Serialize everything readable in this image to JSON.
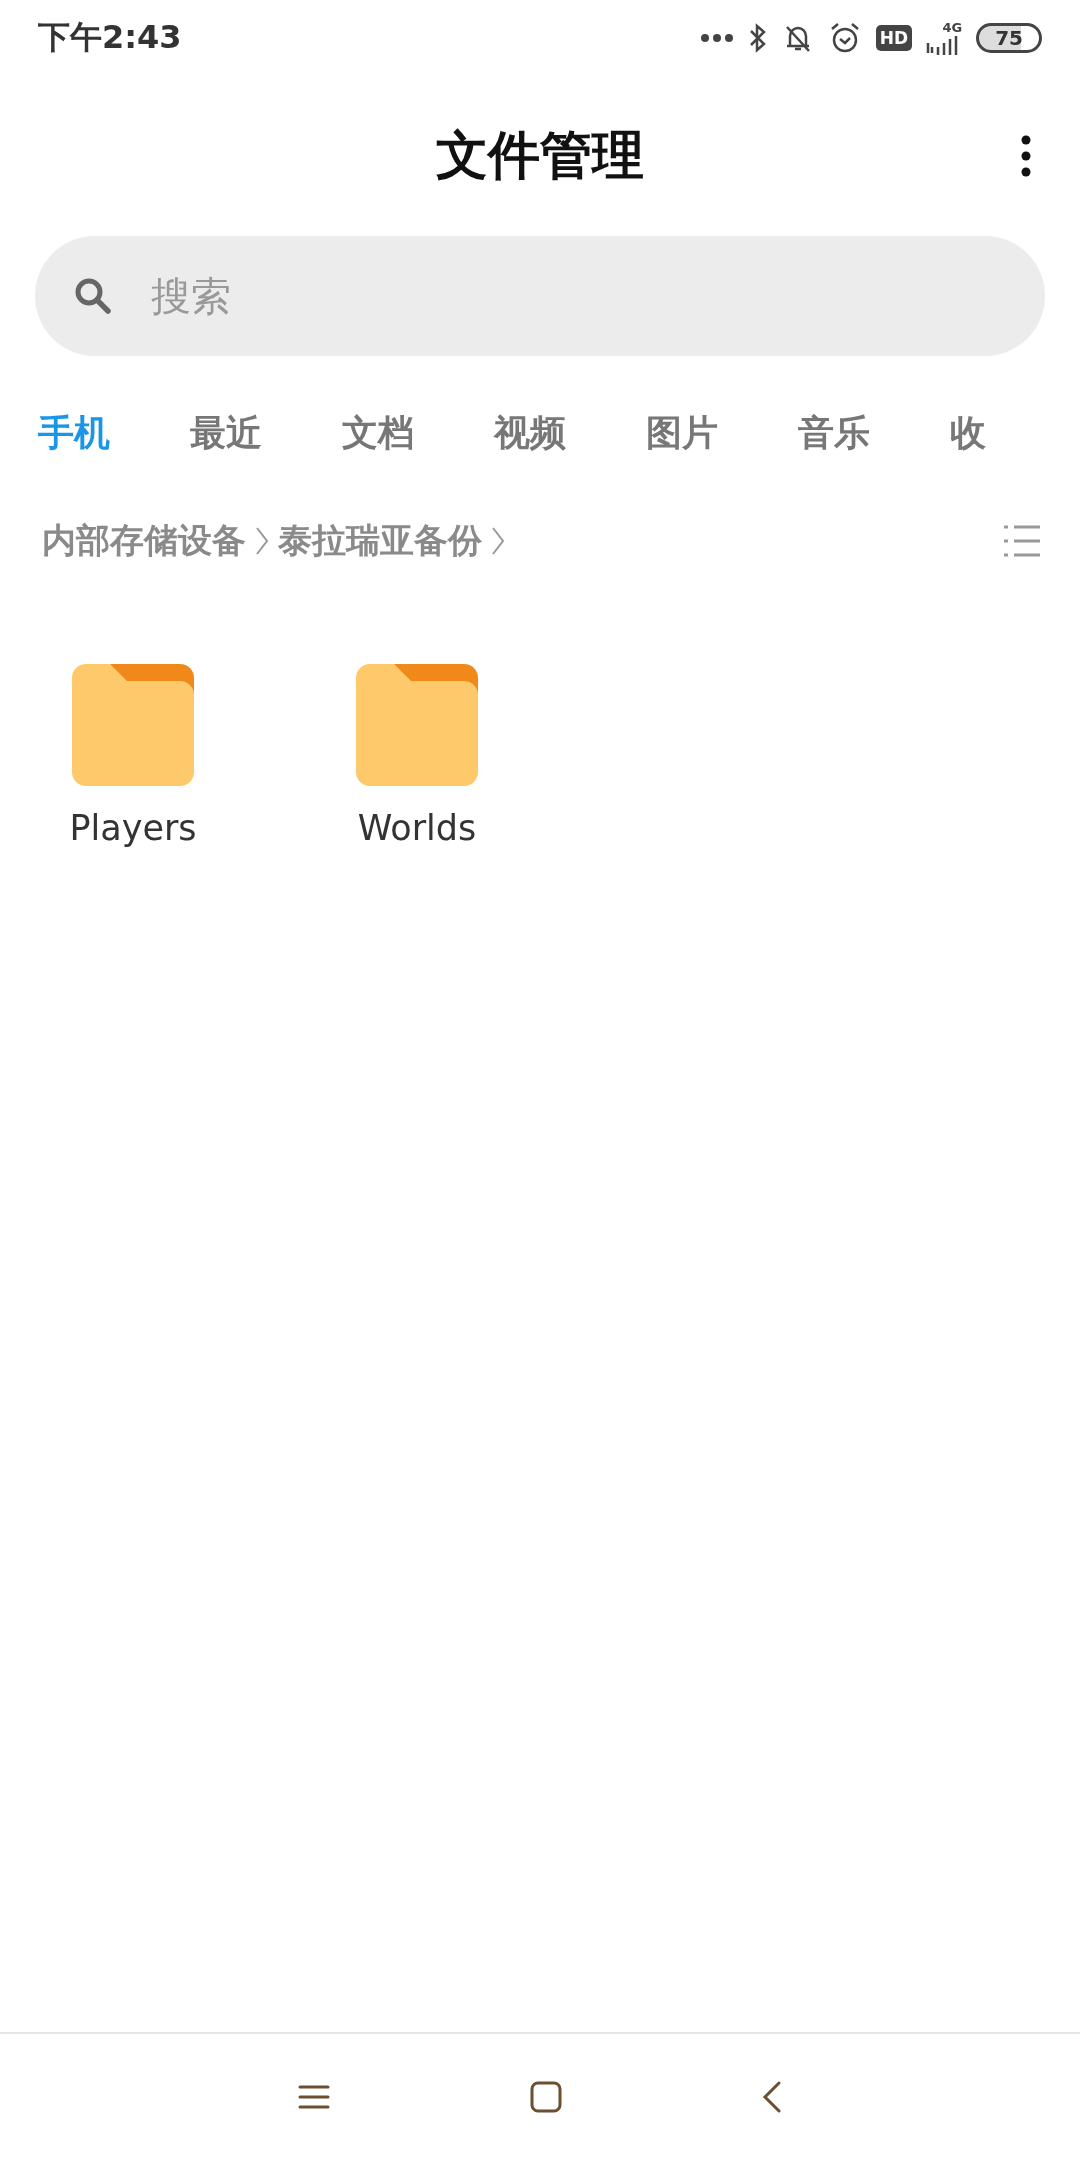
{
  "status_bar": {
    "time": "下午2:43",
    "hd": "HD",
    "network": "4G",
    "battery": "75"
  },
  "title": "文件管理",
  "search": {
    "placeholder": "搜索"
  },
  "tabs": [
    {
      "label": "手机",
      "selected": true
    },
    {
      "label": "最近",
      "selected": false
    },
    {
      "label": "文档",
      "selected": false
    },
    {
      "label": "视频",
      "selected": false
    },
    {
      "label": "图片",
      "selected": false
    },
    {
      "label": "音乐",
      "selected": false
    },
    {
      "label": "收",
      "selected": false
    }
  ],
  "breadcrumb": [
    "内部存储设备",
    "泰拉瑞亚备份"
  ],
  "folders": [
    {
      "name": "Players"
    },
    {
      "name": "Worlds"
    }
  ]
}
